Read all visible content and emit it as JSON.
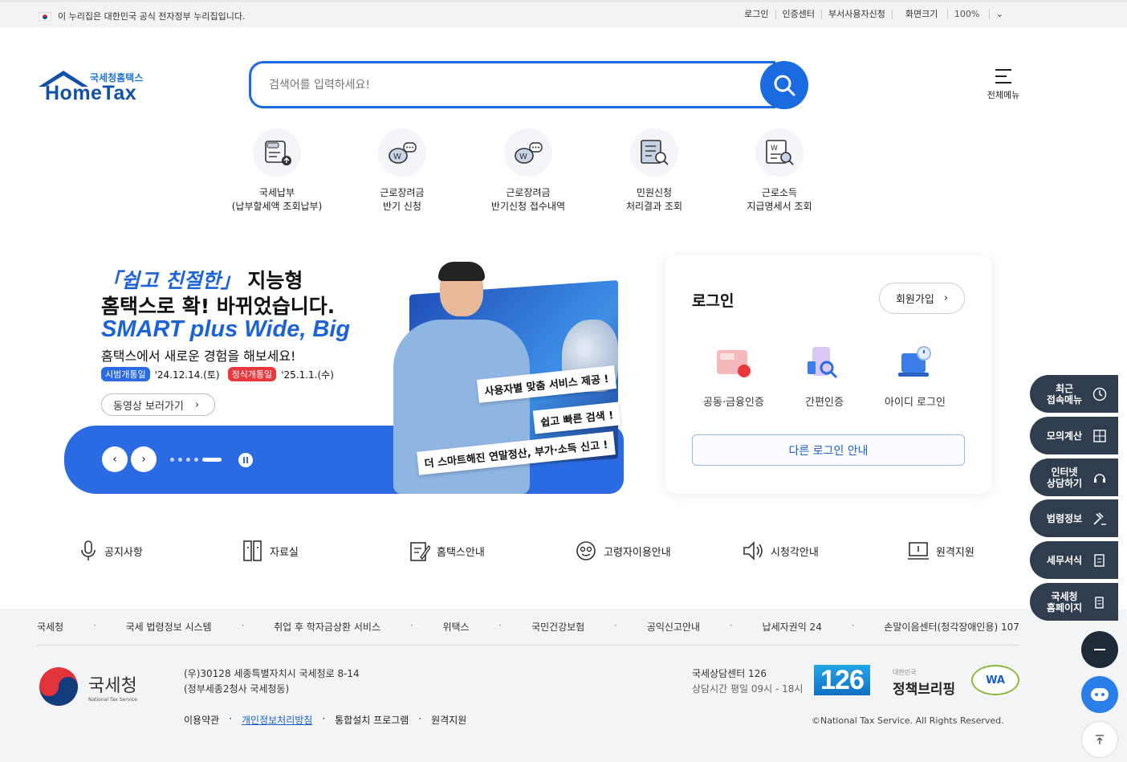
{
  "topbar": {
    "gov_notice": "이 누리집은 대한민국 공식 전자정부 누리집입니다.",
    "links": [
      "로그인",
      "인증센터",
      "부서사용자신청"
    ],
    "zoom_label": "화면크기",
    "zoom_value": "100%"
  },
  "header": {
    "logo_sub": "국세청홈택스",
    "logo_main": "HomeTax",
    "search_placeholder": "검색어를 입력하세요!",
    "all_menu": "전체메뉴"
  },
  "quick_menu": [
    {
      "line1": "국세납부",
      "line2": "(납부할세액 조회납부)"
    },
    {
      "line1": "근로장려금",
      "line2": "반기 신청"
    },
    {
      "line1": "근로장려금",
      "line2": "반기신청 접수내역"
    },
    {
      "line1": "민원신청",
      "line2": "처리결과 조회"
    },
    {
      "line1": "근로소득",
      "line2": "지급명세서 조회"
    }
  ],
  "banner": {
    "line1_highlight": "「쉽고 친절한」",
    "line1_rest": " 지능형",
    "line2": "홈택스로 확! 바뀌었습니다.",
    "line3": "SMART plus Wide, Big",
    "line4": "홈택스에서 새로운 경험을 해보세요!",
    "trial_label": "시범개통일",
    "trial_date": "'24.12.14.(토)",
    "official_label": "정식개통일",
    "official_date": "'25.1.1.(수)",
    "video_button": "동영상 보러가기",
    "tags": [
      "사용자별 맞춤 서비스 제공 !",
      "쉽고 빠른 검색 !",
      "더 스마트해진 연말정산, 부가·소득 신고 !"
    ],
    "slide_count": 5,
    "active_slide": 5
  },
  "login": {
    "title": "로그인",
    "join_button": "회원가입",
    "options": [
      "공동·금융인증",
      "간편인증",
      "아이디 로그인"
    ],
    "other_button": "다른 로그인 안내"
  },
  "links": [
    "공지사항",
    "자료실",
    "홈택스안내",
    "고령자이용안내",
    "시청각안내",
    "원격지원"
  ],
  "side_menu": [
    {
      "line1": "최근",
      "line2": "접속메뉴"
    },
    {
      "line1": "모의계산",
      "line2": ""
    },
    {
      "line1": "인터넷",
      "line2": "상담하기"
    },
    {
      "line1": "법령정보",
      "line2": ""
    },
    {
      "line1": "세무서식",
      "line2": ""
    },
    {
      "line1": "국세청",
      "line2": "홈페이지"
    }
  ],
  "footer": {
    "related": [
      "국세청",
      "국세 법령정보 시스템",
      "취업 후 학자금상환 서비스",
      "위택스",
      "국민건강보험",
      "공익신고안내",
      "납세자권익 24",
      "손말이음센터(청각장애인용) 107"
    ],
    "org_name": "국세청",
    "org_name_en": "National Tax Service",
    "address1": "(우)30128 세종특별자치시 국세청로 8-14",
    "address2": "(정부세종2청사 국세청동)",
    "links": [
      "이용약관",
      "개인정보처리방침",
      "통합설치 프로그램",
      "원격지원"
    ],
    "center_name": "국세상담센터 126",
    "center_hours": "상담시간 평일 09시 - 18시",
    "badge_126": "126",
    "briefing_small": "대한민국",
    "briefing_main": "정책브리핑",
    "wa_mark": "WA",
    "copyright": "©National Tax Service. All Rights Reserved."
  }
}
